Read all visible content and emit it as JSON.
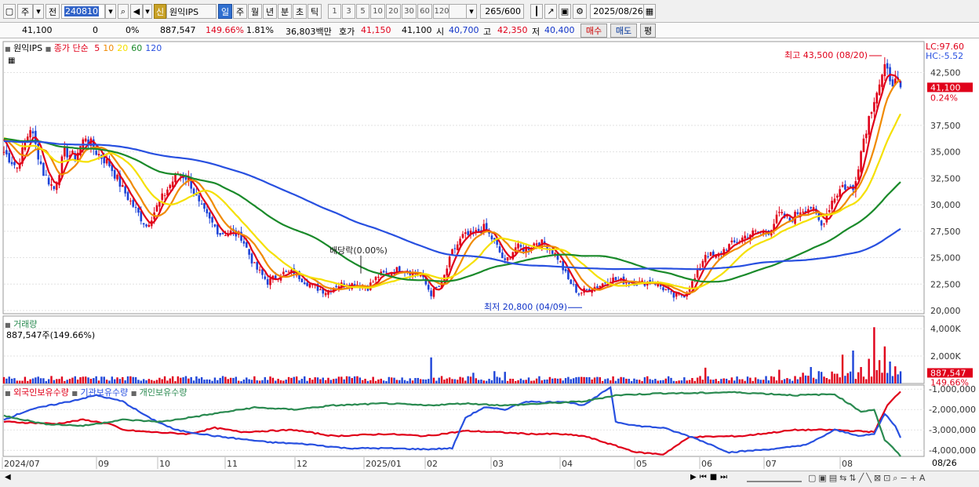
{
  "toolbar": {
    "period_label": "주",
    "prev_label": "전",
    "code": "240810",
    "credit_badge": "신",
    "stock_name": "원익IPS",
    "periods": [
      "일",
      "주",
      "월",
      "년",
      "분",
      "초",
      "틱"
    ],
    "active_period": "일",
    "intervals": [
      "1",
      "3",
      "5",
      "10",
      "20",
      "30",
      "60",
      "120"
    ],
    "count_value": "265",
    "count_total": "/600",
    "date_value": "2025/08/26"
  },
  "quote": {
    "price": "41,100",
    "change": "0",
    "change_pct": "0%",
    "volume": "887,547",
    "volume_ratio": "149.66%",
    "turnover": "1.81%",
    "amount": "36,803백만",
    "bid_label": "호가",
    "bid": "41,150",
    "ask": "41,100",
    "open_label": "시",
    "open": "40,700",
    "high_label": "고",
    "high": "42,350",
    "low_label": "저",
    "low": "40,400",
    "buy_label": "매수",
    "sell_label": "매도",
    "eval_label": "평"
  },
  "price_legend": {
    "name": "원익IPS",
    "title": "종가 단순",
    "ma_labels": [
      "5",
      "10",
      "20",
      "60",
      "120"
    ]
  },
  "volume_legend": {
    "title": "거래량",
    "value": "887,547주(149.66%)"
  },
  "holdings_legend": {
    "labels": [
      "외국인보유수량",
      "기관보유수량",
      "개인보유수량"
    ]
  },
  "bottom_right_label": "08/26",
  "colors": {
    "up": "#e0001a",
    "down": "#1e44d8",
    "ma5": "#e0001a",
    "ma10": "#f08a00",
    "ma20": "#f5e000",
    "ma60": "#1a8a2a",
    "ma120": "#2850e0",
    "foreign": "#e0001a",
    "institution": "#2850e0",
    "individual": "#2a8a50"
  },
  "chart_data": [
    {
      "type": "candlestick",
      "title": "원익IPS 종가 단순",
      "x_ticks": [
        "2024/07",
        "09",
        "10",
        "11",
        "12",
        "2025/01",
        "02",
        "03",
        "04",
        "05",
        "06",
        "07",
        "08"
      ],
      "ylim": [
        20000,
        43500
      ],
      "y_ticks": [
        "20,000",
        "22,500",
        "25,000",
        "27,500",
        "30,000",
        "32,500",
        "35,000",
        "37,500",
        "42,500"
      ],
      "y_tick_values": [
        20000,
        22500,
        25000,
        27500,
        30000,
        32500,
        35000,
        37500,
        42500
      ],
      "close_anchors": [
        [
          0,
          35000
        ],
        [
          5,
          33500
        ],
        [
          10,
          37300
        ],
        [
          15,
          33000
        ],
        [
          19,
          31500
        ],
        [
          23,
          35000
        ],
        [
          27,
          34500
        ],
        [
          31,
          36500
        ],
        [
          35,
          35000
        ],
        [
          40,
          33800
        ],
        [
          45,
          31500
        ],
        [
          50,
          29500
        ],
        [
          54,
          28000
        ],
        [
          58,
          29800
        ],
        [
          62,
          31500
        ],
        [
          66,
          33000
        ],
        [
          70,
          32500
        ],
        [
          74,
          30000
        ],
        [
          78,
          28500
        ],
        [
          82,
          27300
        ],
        [
          86,
          27400
        ],
        [
          90,
          27000
        ],
        [
          95,
          24200
        ],
        [
          100,
          22700
        ],
        [
          105,
          23500
        ],
        [
          110,
          23600
        ],
        [
          114,
          22800
        ],
        [
          118,
          22200
        ],
        [
          122,
          21800
        ],
        [
          126,
          22400
        ],
        [
          130,
          22500
        ],
        [
          134,
          22500
        ],
        [
          138,
          22200
        ],
        [
          142,
          23300
        ],
        [
          146,
          23600
        ],
        [
          150,
          23900
        ],
        [
          154,
          23700
        ],
        [
          158,
          23300
        ],
        [
          162,
          21600
        ],
        [
          166,
          22500
        ],
        [
          170,
          25500
        ],
        [
          174,
          27000
        ],
        [
          178,
          27200
        ],
        [
          182,
          27800
        ],
        [
          186,
          26500
        ],
        [
          190,
          24500
        ],
        [
          194,
          26000
        ],
        [
          198,
          25800
        ],
        [
          202,
          26500
        ],
        [
          206,
          26200
        ],
        [
          210,
          25000
        ],
        [
          214,
          22900
        ],
        [
          218,
          21600
        ],
        [
          222,
          22100
        ],
        [
          226,
          22400
        ],
        [
          230,
          23000
        ],
        [
          234,
          22800
        ],
        [
          238,
          22700
        ],
        [
          242,
          22600
        ],
        [
          246,
          22800
        ],
        [
          250,
          22100
        ],
        [
          254,
          21300
        ],
        [
          258,
          21500
        ],
        [
          262,
          23000
        ],
        [
          266,
          25400
        ],
        [
          270,
          25000
        ],
        [
          274,
          26000
        ],
        [
          278,
          26500
        ],
        [
          282,
          27200
        ],
        [
          286,
          27400
        ],
        [
          290,
          27500
        ],
        [
          294,
          29100
        ],
        [
          298,
          28500
        ],
        [
          302,
          29500
        ],
        [
          306,
          29800
        ],
        [
          310,
          28000
        ],
        [
          314,
          30400
        ],
        [
          318,
          31800
        ],
        [
          322,
          31400
        ],
        [
          326,
          36300
        ],
        [
          330,
          40200
        ],
        [
          334,
          42700
        ],
        [
          338,
          41500
        ],
        [
          340,
          41100
        ]
      ],
      "ma_series": [
        {
          "name": "5",
          "period": 5
        },
        {
          "name": "10",
          "period": 10
        },
        {
          "name": "20",
          "period": 20
        },
        {
          "name": "60",
          "period": 60
        },
        {
          "name": "120",
          "period": 120
        }
      ],
      "annotations": [
        {
          "text": "최고 43,500 (08/20)",
          "value": 43500
        },
        {
          "text": "최저 20,800 (04/09)",
          "value": 20800
        },
        {
          "text": "배당락(0.00%)",
          "value": 23600
        }
      ],
      "right_labels": {
        "lc": "LC:97.60",
        "hc": "HC:-5.52",
        "last": "41,100",
        "pct": "0.24%"
      }
    },
    {
      "type": "bar",
      "title": "거래량",
      "ylim": [
        0,
        4800000
      ],
      "y_ticks": [
        "4,000K",
        "2,000K"
      ],
      "y_tick_values": [
        4000000,
        2000000
      ],
      "last_value_label": "887,547",
      "last_pct_label": "149.66%",
      "spikes": [
        {
          "i": 162,
          "v": 1900000
        },
        {
          "i": 178,
          "v": 780000
        },
        {
          "i": 186,
          "v": 900000
        },
        {
          "i": 190,
          "v": 850000
        },
        {
          "i": 266,
          "v": 1150000
        },
        {
          "i": 294,
          "v": 1000000
        },
        {
          "i": 306,
          "v": 1200000
        },
        {
          "i": 314,
          "v": 870000
        },
        {
          "i": 318,
          "v": 2100000
        },
        {
          "i": 322,
          "v": 2400000
        },
        {
          "i": 325,
          "v": 1200000
        },
        {
          "i": 328,
          "v": 1800000
        },
        {
          "i": 330,
          "v": 4100000
        },
        {
          "i": 332,
          "v": 1700000
        },
        {
          "i": 334,
          "v": 2700000
        },
        {
          "i": 336,
          "v": 1600000
        },
        {
          "i": 338,
          "v": 1250000
        },
        {
          "i": 340,
          "v": 887547
        }
      ],
      "base_volume": 420000
    },
    {
      "type": "line",
      "title": "외국인보유수량 / 기관보유수량 / 개인보유수량",
      "ylim": [
        -4300000,
        -800000
      ],
      "y_ticks": [
        "-1,000,000",
        "-2,000,000",
        "-3,000,000",
        "-4,000,000"
      ],
      "y_tick_values": [
        -1000000,
        -2000000,
        -3000000,
        -4000000
      ],
      "series": [
        {
          "name": "외국인보유수량",
          "anchors": [
            [
              0,
              -2600000
            ],
            [
              20,
              -2700000
            ],
            [
              30,
              -2500000
            ],
            [
              40,
              -2700000
            ],
            [
              45,
              -3000000
            ],
            [
              55,
              -3100000
            ],
            [
              70,
              -3200000
            ],
            [
              80,
              -2900000
            ],
            [
              90,
              -3100000
            ],
            [
              110,
              -3000000
            ],
            [
              125,
              -3300000
            ],
            [
              145,
              -3200000
            ],
            [
              160,
              -3300000
            ],
            [
              175,
              -3050000
            ],
            [
              185,
              -3100000
            ],
            [
              200,
              -3200000
            ],
            [
              210,
              -3200000
            ],
            [
              220,
              -3300000
            ],
            [
              240,
              -4100000
            ],
            [
              250,
              -4200000
            ],
            [
              260,
              -3350000
            ],
            [
              280,
              -3300000
            ],
            [
              300,
              -3000000
            ],
            [
              315,
              -3000000
            ],
            [
              330,
              -3100000
            ],
            [
              335,
              -1800000
            ],
            [
              340,
              -1100000
            ]
          ]
        },
        {
          "name": "기관보유수량",
          "anchors": [
            [
              0,
              -2500000
            ],
            [
              10,
              -2000000
            ],
            [
              25,
              -1600000
            ],
            [
              35,
              -1300000
            ],
            [
              45,
              -1600000
            ],
            [
              55,
              -2400000
            ],
            [
              65,
              -3000000
            ],
            [
              80,
              -3300000
            ],
            [
              100,
              -3600000
            ],
            [
              115,
              -3700000
            ],
            [
              130,
              -3900000
            ],
            [
              145,
              -3900000
            ],
            [
              160,
              -3950000
            ],
            [
              170,
              -3900000
            ],
            [
              175,
              -2400000
            ],
            [
              182,
              -1900000
            ],
            [
              190,
              -2000000
            ],
            [
              198,
              -1600000
            ],
            [
              205,
              -1650000
            ],
            [
              212,
              -1600000
            ],
            [
              220,
              -1800000
            ],
            [
              230,
              -900000
            ],
            [
              232,
              -2600000
            ],
            [
              240,
              -2800000
            ],
            [
              250,
              -2900000
            ],
            [
              262,
              -3400000
            ],
            [
              275,
              -4100000
            ],
            [
              285,
              -4000000
            ],
            [
              295,
              -3900000
            ],
            [
              305,
              -3700000
            ],
            [
              315,
              -3000000
            ],
            [
              325,
              -3300000
            ],
            [
              330,
              -3200000
            ],
            [
              334,
              -2200000
            ],
            [
              338,
              -2800000
            ],
            [
              340,
              -3400000
            ]
          ]
        },
        {
          "name": "개인보유수량",
          "anchors": [
            [
              0,
              -2300000
            ],
            [
              15,
              -2700000
            ],
            [
              30,
              -2800000
            ],
            [
              45,
              -2500000
            ],
            [
              60,
              -2600000
            ],
            [
              80,
              -2200000
            ],
            [
              95,
              -1900000
            ],
            [
              110,
              -2000000
            ],
            [
              125,
              -1800000
            ],
            [
              145,
              -1700000
            ],
            [
              160,
              -1800000
            ],
            [
              175,
              -1700000
            ],
            [
              190,
              -1800000
            ],
            [
              205,
              -1700000
            ],
            [
              220,
              -1600000
            ],
            [
              232,
              -1300000
            ],
            [
              250,
              -1200000
            ],
            [
              262,
              -1200000
            ],
            [
              275,
              -1150000
            ],
            [
              285,
              -1200000
            ],
            [
              300,
              -1300000
            ],
            [
              315,
              -1250000
            ],
            [
              325,
              -2100000
            ],
            [
              330,
              -2000000
            ],
            [
              334,
              -3500000
            ],
            [
              338,
              -4000000
            ],
            [
              340,
              -4300000
            ]
          ]
        }
      ]
    }
  ]
}
